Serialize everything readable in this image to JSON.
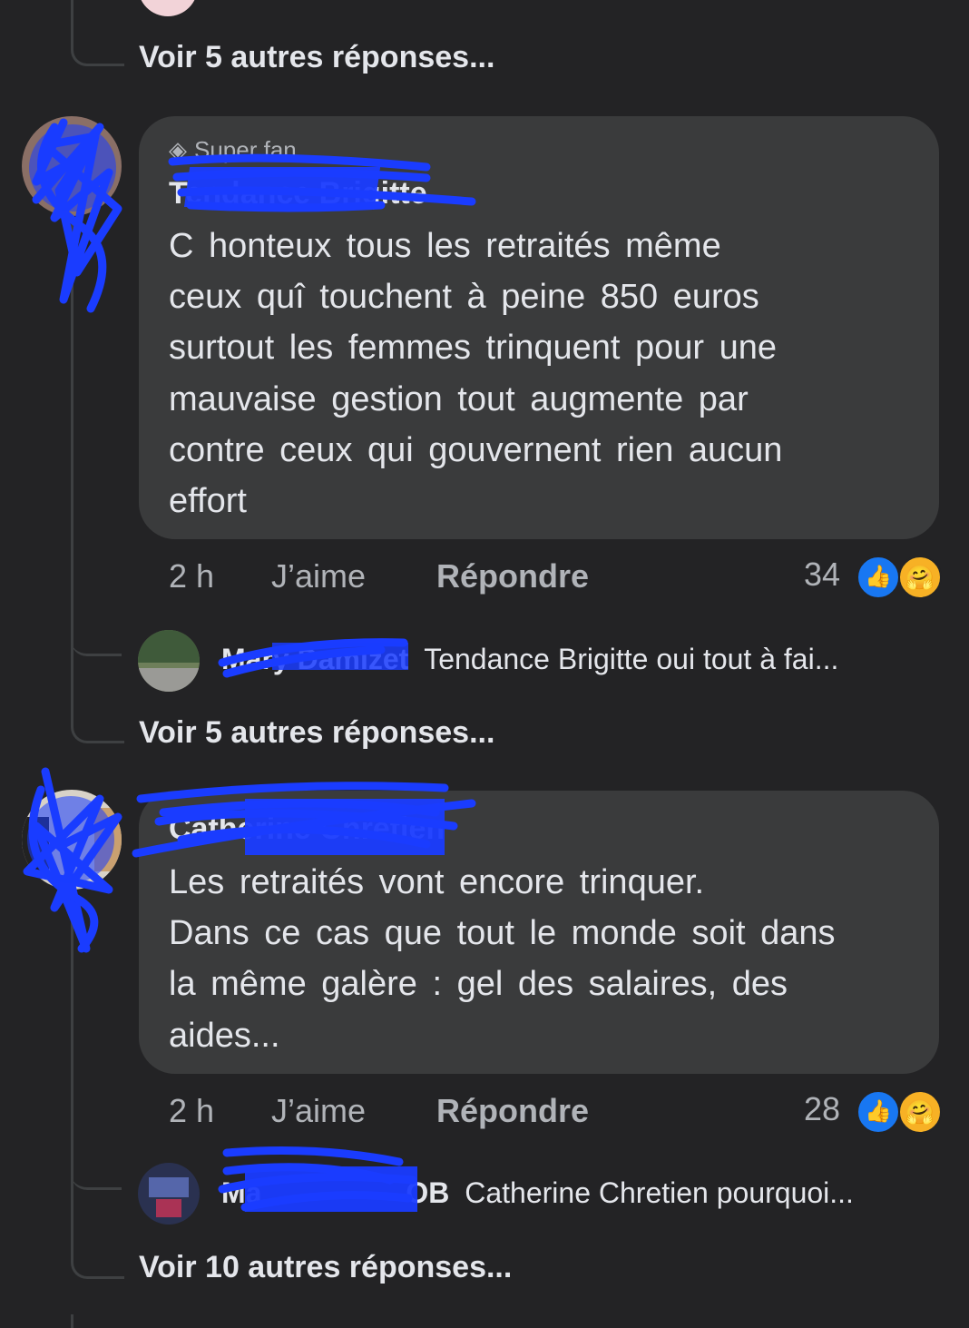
{
  "thread_top": {
    "more_replies": "Voir 5 autres réponses..."
  },
  "comments": [
    {
      "badge": "Super fan",
      "author": "Tendance Brigitte",
      "text_lines": [
        "C honteux tous les retraités même",
        "ceux quî touchent à peine 850 euros",
        "surtout les femmes trinquent pour une",
        "mauvaise gestion tout augmente par",
        "contre ceux qui gouvernent rien aucun",
        "effort"
      ],
      "time": "2 h",
      "like_label": "J’aime",
      "reply_label": "Répondre",
      "reaction_count": "34",
      "reply_preview": {
        "author": "Mary Damizet",
        "text": "Tendance Brigitte oui tout à fai..."
      },
      "more_replies": "Voir 5 autres réponses..."
    },
    {
      "author": "Catherine Chretien",
      "text_lines": [
        "Les retraités vont encore trinquer.",
        "Dans ce cas que tout le monde soit dans",
        "la même galère : gel des salaires, des",
        "aides..."
      ],
      "time": "2 h",
      "like_label": "J’aime",
      "reply_label": "Répondre",
      "reaction_count": "28",
      "reply_preview": {
        "author": "Ma OB",
        "text": "Catherine Chretien pourquoi..."
      },
      "more_replies": "Voir 10 autres réponses..."
    }
  ],
  "colors": {
    "like_blue": "#1877f2",
    "care_yellow": "#f7b125",
    "redaction": "#1a3cff"
  }
}
